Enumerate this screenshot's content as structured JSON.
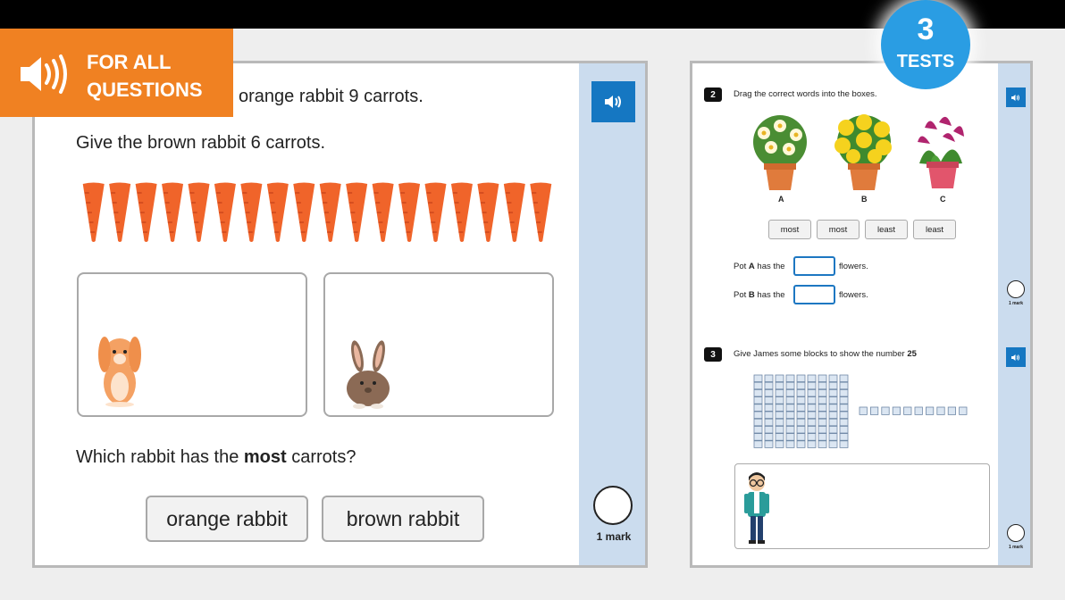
{
  "badge": {
    "line1": "FOR ALL",
    "line2": "QUESTIONS",
    "icon": "speaker-icon",
    "color": "#f08122"
  },
  "tests_badge": {
    "number": "3",
    "label": "TESTS",
    "color": "#2a9de3"
  },
  "left_question": {
    "line1": "orange rabbit 9 carrots.",
    "line2": "Give the brown rabbit 6 carrots.",
    "carrot_count": 18,
    "question_prefix": "Which rabbit has the ",
    "question_bold": "most",
    "question_suffix": " carrots?",
    "answers": [
      "orange rabbit",
      "brown rabbit"
    ],
    "mark": "1 mark"
  },
  "right_panel": {
    "q2": {
      "number": "2",
      "prompt": "Drag the correct words into the boxes.",
      "pots": [
        "A",
        "B",
        "C"
      ],
      "words": [
        "most",
        "most",
        "least",
        "least"
      ],
      "row1": {
        "prefix": "Pot ",
        "pot": "A",
        "middle": " has the",
        "suffix": "flowers."
      },
      "row2": {
        "prefix": "Pot ",
        "pot": "B",
        "middle": " has the",
        "suffix": "flowers."
      },
      "mark": "1 mark"
    },
    "q3": {
      "number": "3",
      "prompt_prefix": "Give James some blocks to show the number ",
      "prompt_bold": "25",
      "tens_rods": 9,
      "ones_cubes": 10,
      "mark": "1 mark"
    }
  },
  "colors": {
    "accent_blue": "#1577c2",
    "side_blue": "#cbdcee",
    "carrot": "#f0642a"
  }
}
